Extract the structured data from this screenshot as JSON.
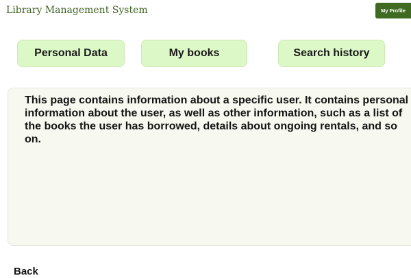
{
  "header": {
    "app_title": "Library Management System",
    "profile_button_label": "My Profile"
  },
  "tabs": [
    {
      "label": "Personal Data"
    },
    {
      "label": "My books"
    },
    {
      "label": "Search history"
    }
  ],
  "content": {
    "description": "This page contains information about a specific user. It contains personal information about the user, as well as other information, such as a list of the books the user has borrowed, details about ongoing rentals, and so on."
  },
  "footer": {
    "back_label": "Back"
  },
  "colors": {
    "brand_green": "#3f6a22",
    "tab_background": "#dcf8c6",
    "panel_background": "#f7f8ef"
  }
}
